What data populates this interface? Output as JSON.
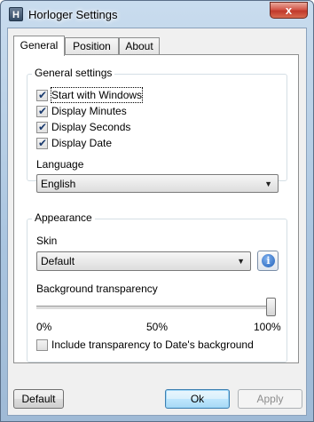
{
  "window": {
    "title": "Horloger Settings",
    "app_icon": "H",
    "close_glyph": "x"
  },
  "tabs": [
    {
      "label": "General",
      "active": true
    },
    {
      "label": "Position",
      "active": false
    },
    {
      "label": "About",
      "active": false
    }
  ],
  "general_settings": {
    "title": "General settings",
    "checkboxes": [
      {
        "label": "Start with Windows",
        "checked": true
      },
      {
        "label": "Display Minutes",
        "checked": true
      },
      {
        "label": "Display Seconds",
        "checked": true
      },
      {
        "label": "Display Date",
        "checked": true
      }
    ],
    "language_label": "Language",
    "language_value": "English"
  },
  "appearance": {
    "title": "Appearance",
    "skin_label": "Skin",
    "skin_value": "Default",
    "info_icon": "i",
    "transparency_label": "Background transparency",
    "transparency_value": 1.0,
    "ticks": [
      "0%",
      "50%",
      "100%"
    ],
    "include_date_label": "Include transparency to Date's background",
    "include_date_checked": false
  },
  "buttons": {
    "default": "Default",
    "ok": "Ok",
    "apply": "Apply"
  },
  "colors": {
    "close": "#c0392b",
    "info": "#1f5fb8"
  }
}
